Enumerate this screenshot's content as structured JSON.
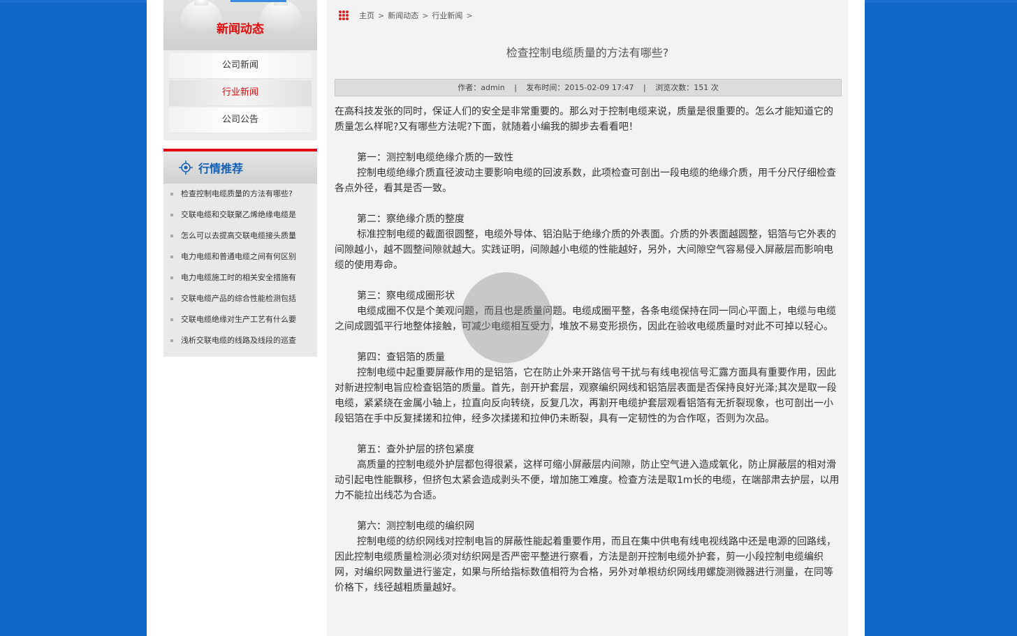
{
  "sidebar": {
    "header_title": "新闻动态",
    "menu": [
      {
        "label": "公司新闻",
        "active": false
      },
      {
        "label": "行业新闻",
        "active": true
      },
      {
        "label": "公司公告",
        "active": false
      }
    ],
    "recommend_title": "行情推荐",
    "recommend_items": [
      "检查控制电缆质量的方法有哪些?",
      "交联电缆和交联聚乙烯绝缘电缆是",
      "怎么可以去提高交联电缆接头质量",
      "电力电缆和普通电缆之间有何区别",
      "电力电缆施工时的相关安全措施有",
      "交联电缆产品的综合性能检测包括",
      "交联电缆绝缘对生产工艺有什么要",
      "浅析交联电缆的线路及线段的巡查"
    ]
  },
  "breadcrumb": {
    "items": [
      "主页",
      "新闻动态",
      "行业新闻"
    ],
    "separator": ">"
  },
  "article": {
    "title": "检查控制电缆质量的方法有哪些?",
    "meta": {
      "author": "作者：admin",
      "published": "发布时间：2015-02-09 17:47",
      "views": "浏览次数：151 次",
      "separator": "|"
    },
    "intro": "在高科技发张的同时，保证人们的安全是非常重要的。那么对于控制电缆来说，质量是很重要的。怎么才能知道它的质量怎么样呢?又有哪些方法呢?下面，就随着小编我的脚步去看看吧！",
    "sections": [
      {
        "heading": "第一：测控制电缆绝缘介质的一致性",
        "text": "控制电缆绝缘介质直径波动主要影响电缆的回波系数，此项检查可剖出一段电缆的绝缘介质，用千分尺仔细检查各点外径，看其是否一致。"
      },
      {
        "heading": "第二：察绝缘介质的整度",
        "text": "标准控制电缆的截面很圆整，电缆外导体、铝泊贴于绝缘介质的外表面。介质的外表面越圆整，铝箔与它外表的间隙越小，越不圆整间隙就越大。实践证明，间隙越小电缆的性能越好，另外，大间隙空气容易侵入屏蔽层而影响电缆的使用寿命。"
      },
      {
        "heading": "第三：察电缆成圈形状",
        "text": "电缆成圈不仅是个美观问题，而且也是质量问题。电缆成圈平整，各条电缆保持在同一同心平面上，电缆与电缆之间成圆弧平行地整体接触，可减少电缆相互受力，堆放不易变形损伤，因此在验收电缆质量时对此不可掉以轻心。"
      },
      {
        "heading": "第四：查铝箔的质量",
        "text": "控制电缆中起重要屏蔽作用的是铝箔，它在防止外来开路信号干扰与有线电视信号汇露方面具有重要作用，因此对新进控制电旨应检查铝箔的质量。首先，剖开护套层，观察编织网线和铝箔层表面是否保持良好光泽;其次是取一段电缆，紧紧绕在金属小轴上，拉直向反向转绕，反复几次，再割开电缆护套层观看铝箔有无折裂现象，也可剖出一小段铝箔在手中反复揉搓和拉伸，经多次揉搓和拉伸仍未断裂，具有一定韧性的为合作呕，否则为次品。"
      },
      {
        "heading": "第五：查外护层的挤包紧度",
        "text": "高质量的控制电缆外护层都包得很紧，这样可缩小屏蔽层内间隙，防止空气进入造成氧化，防止屏蔽层的相对滑动引起电性能飘移，但挤包太紧会造成剥头不便，增加施工难度。检查方法是取1m长的电缆，在端部肃去护层，以用力不能拉出线芯为合适。"
      },
      {
        "heading": "第六：测控制电缆的编织网",
        "text": "控制电缆的纺织网线对控制电旨的屏蔽性能起着重要作用，而且在集中供电有线电视线路中还是电源的回路线，因此控制电缆质量检测必须对纺织网是否严密平整进行察看，方法是剖开控制电缆外护套，剪一小段控制电缆编织网，对编织网数量进行鉴定，如果与所给指标数值相符为合格，另外对单根纺织网线用螺旋测微器进行测量，在同等价格下，线径越粗质量越好。"
      }
    ]
  },
  "colors": {
    "background": "#0f68c7",
    "accent_red": "#e60012",
    "accent_blue": "#1060b8"
  }
}
